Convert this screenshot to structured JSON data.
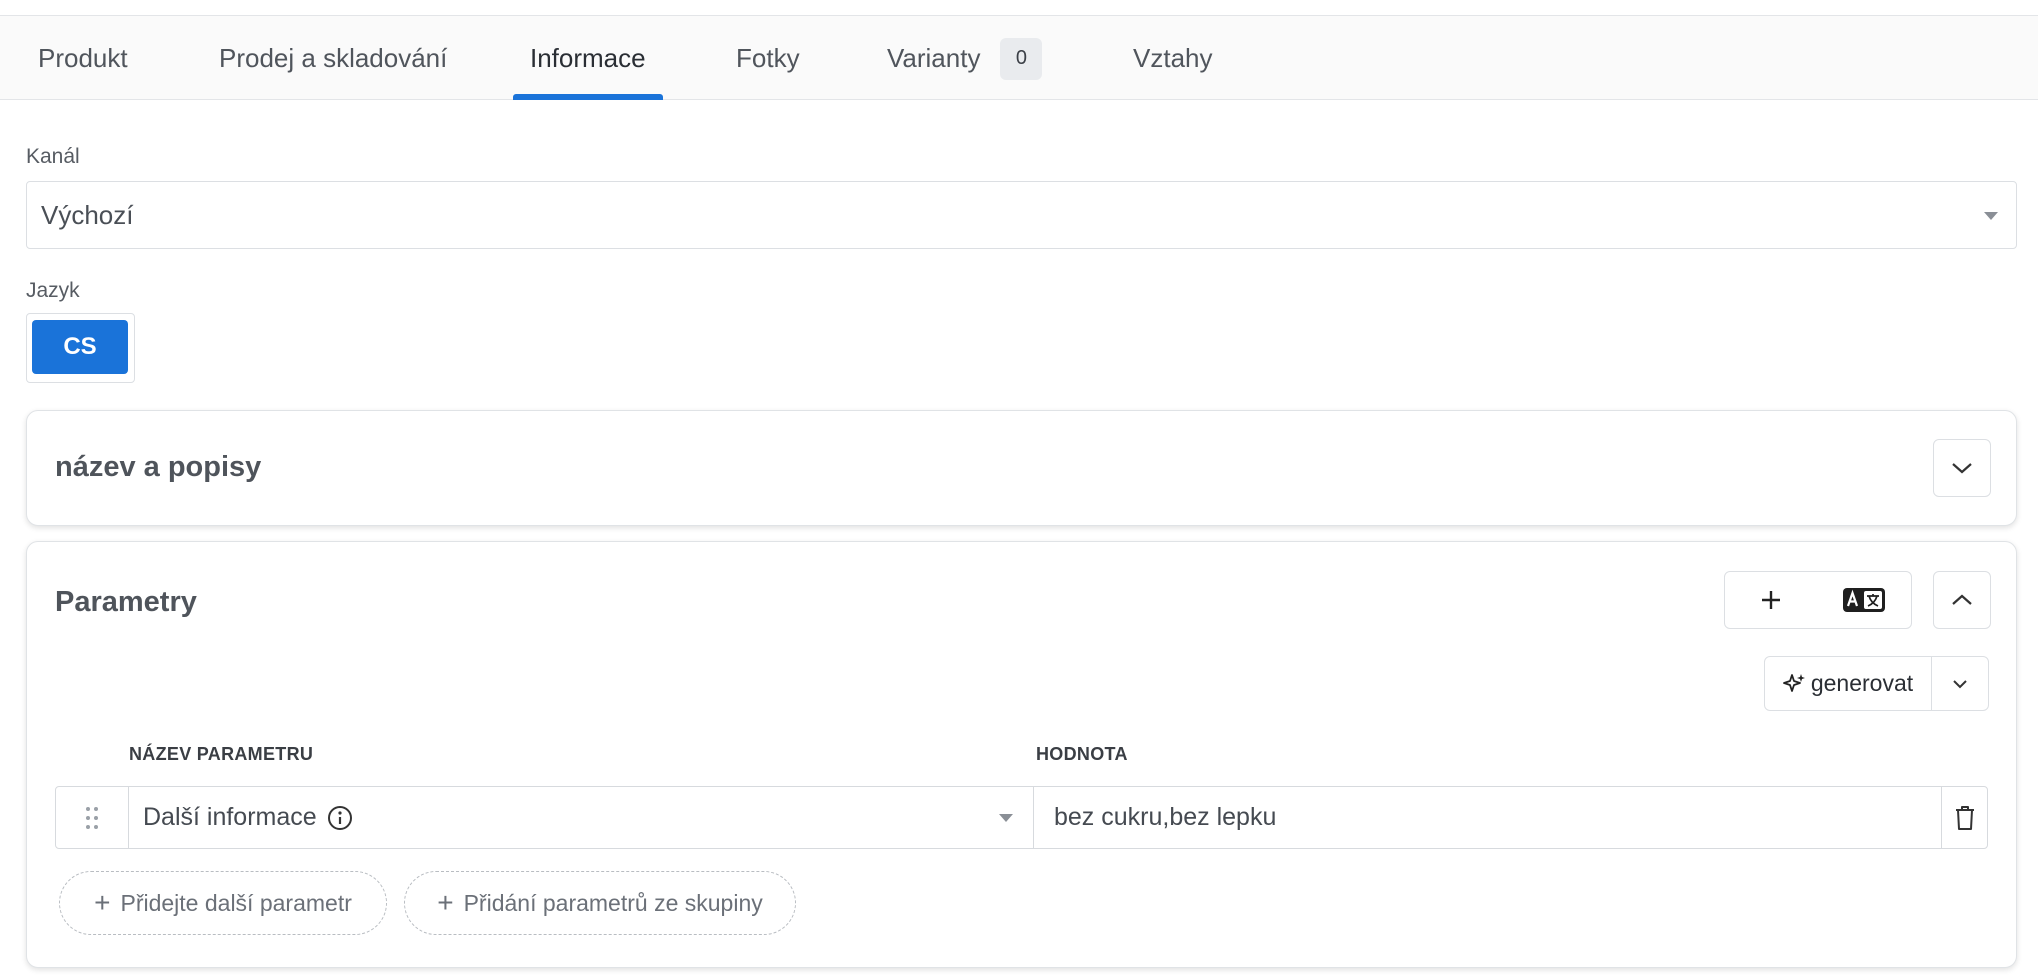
{
  "tabs": [
    {
      "label": "Produkt"
    },
    {
      "label": "Prodej a skladování"
    },
    {
      "label": "Informace",
      "active": true
    },
    {
      "label": "Fotky"
    },
    {
      "label": "Varianty",
      "count": "0"
    },
    {
      "label": "Vztahy"
    }
  ],
  "channel": {
    "label": "Kanál",
    "value": "Výchozí"
  },
  "language": {
    "label": "Jazyk",
    "selected": "CS"
  },
  "names_section": {
    "title": "název a popisy"
  },
  "params_section": {
    "title": "Parametry",
    "generate_label": "generovat",
    "columns": {
      "name": "NÁZEV PARAMETRU",
      "value": "HODNOTA"
    },
    "rows": [
      {
        "name": "Další informace",
        "value": "bez cukru,bez lepku"
      }
    ],
    "add_param_label": "Přidejte další parametr",
    "add_group_label": "Přidání parametrů ze skupiny"
  },
  "colors": {
    "accent": "#1a73d9"
  }
}
